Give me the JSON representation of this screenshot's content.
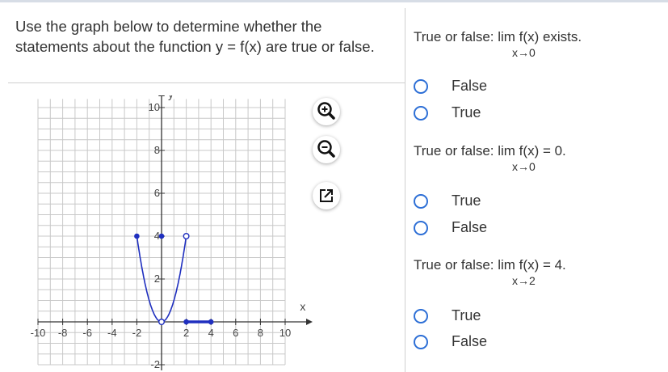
{
  "prompt": "Use the graph below to determine whether the statements about the function y = f(x) are true or false.",
  "graph": {
    "x_ticks": [
      "-10",
      "-8",
      "-6",
      "-4",
      "-2",
      "2",
      "4",
      "6",
      "8",
      "10"
    ],
    "y_ticks": [
      "10",
      "8",
      "6",
      "4",
      "2",
      "-2"
    ],
    "x_label": "x",
    "y_label": "y",
    "colors": {
      "curve": "#1f2fbf",
      "grid": "#c8c8c8",
      "axis": "#333333"
    }
  },
  "tools": {
    "zoom_in_icon": "zoom-in-icon",
    "zoom_out_icon": "zoom-out-icon",
    "popout_icon": "popout-icon"
  },
  "questions": [
    {
      "text": "True or false:  lim f(x) exists.",
      "sub": "x→0",
      "options": [
        "False",
        "True"
      ]
    },
    {
      "text": "True or false:  lim f(x) = 0.",
      "sub": "x→0",
      "options": [
        "True",
        "False"
      ]
    },
    {
      "text": "True or false:  lim f(x) = 4.",
      "sub": "x→2",
      "options": [
        "True",
        "False"
      ]
    }
  ]
}
